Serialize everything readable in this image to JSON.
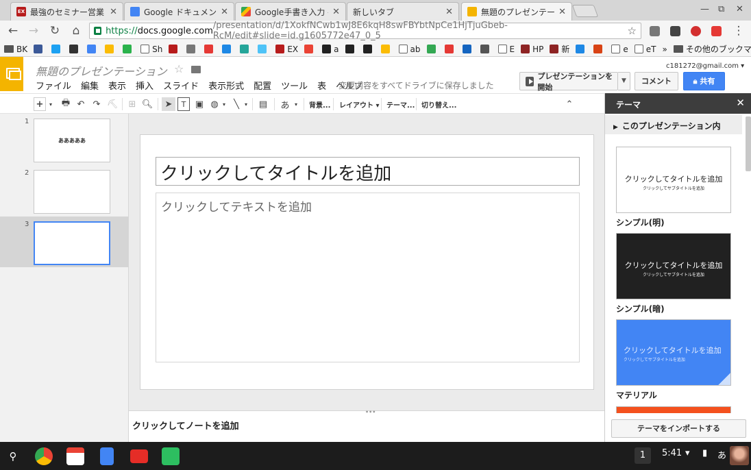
{
  "browser": {
    "tabs": [
      {
        "title": "最強のセミナー営業・",
        "favicon": "ex-icon",
        "color": "#b71c1c"
      },
      {
        "title": "Google ドキュメント",
        "favicon": "docs-icon",
        "color": "#4285f4"
      },
      {
        "title": "Google手書き入力 - Go",
        "favicon": "play-icon",
        "color": "#34a853"
      },
      {
        "title": "新しいタブ",
        "favicon": "",
        "color": ""
      },
      {
        "title": "無題のプレゼンテーシ",
        "favicon": "slides-icon",
        "color": "#f4b400"
      }
    ],
    "url": {
      "scheme": "https://",
      "host": "docs.google.com",
      "path": "/presentation/d/1XokfNCwb1wJ8E6kqH8swFBYbtNpCe1HjTjuGbeb-RcM/edit#slide=id.g1605772e47_0_5"
    },
    "bookmarks": [
      {
        "label": "BK",
        "icon": "folder-icon"
      },
      {
        "label": "",
        "icon": "facebook-icon"
      },
      {
        "label": "",
        "icon": "twitter-icon"
      },
      {
        "label": "",
        "icon": "bookmark-icon"
      },
      {
        "label": "",
        "icon": "google-icon"
      },
      {
        "label": "",
        "icon": "adwords-icon"
      },
      {
        "label": "",
        "icon": "feedly-icon"
      },
      {
        "label": "Sh",
        "icon": "page-icon"
      },
      {
        "label": "",
        "icon": "ex-icon"
      },
      {
        "label": "",
        "icon": "store-icon"
      },
      {
        "label": "",
        "icon": "ring-icon"
      },
      {
        "label": "",
        "icon": "chat-icon"
      },
      {
        "label": "",
        "icon": "app-icon"
      },
      {
        "label": "",
        "icon": "app2-icon"
      },
      {
        "label": "EX",
        "icon": "ex-icon"
      },
      {
        "label": "",
        "icon": "gmail-icon"
      },
      {
        "label": "a",
        "icon": "amazon-icon"
      },
      {
        "label": "",
        "icon": "t-icon"
      },
      {
        "label": "",
        "icon": "amazon-icon"
      },
      {
        "label": "",
        "icon": "photos-icon"
      },
      {
        "label": "ab",
        "icon": "page-icon"
      },
      {
        "label": "",
        "icon": "drive-icon"
      },
      {
        "label": "",
        "icon": "m-icon"
      },
      {
        "label": "",
        "icon": "arrow-icon"
      },
      {
        "label": "",
        "icon": "apple-icon"
      },
      {
        "label": "E",
        "icon": "page-icon"
      },
      {
        "label": "HP",
        "icon": "tax-icon"
      },
      {
        "label": "新",
        "icon": "tax-icon"
      },
      {
        "label": "",
        "icon": "mf-icon"
      },
      {
        "label": "",
        "icon": "time-icon"
      },
      {
        "label": "e",
        "icon": "page-icon"
      },
      {
        "label": "eT",
        "icon": "page-icon"
      }
    ],
    "bookmarks_overflow": "»",
    "other_bookmarks": "その他のブックマーク"
  },
  "app": {
    "doc_title": "無題のプレゼンテーション",
    "account": "c181272@gmail.com",
    "menu": [
      "ファイル",
      "編集",
      "表示",
      "挿入",
      "スライド",
      "表示形式",
      "配置",
      "ツール",
      "表",
      "ヘルプ"
    ],
    "save_status": "変更内容をすべてドライブに保存しました",
    "present_label": "プレゼンテーションを開始",
    "comment_label": "コメント",
    "share_label": "共有"
  },
  "toolbar": {
    "input_tool": "あ",
    "background": "背景...",
    "layout": "レイアウト",
    "theme": "テーマ...",
    "transition": "切り替え..."
  },
  "slides": [
    {
      "number": "1",
      "thumb_text": "あああああ",
      "selected": false
    },
    {
      "number": "2",
      "thumb_text": "",
      "selected": false
    },
    {
      "number": "3",
      "thumb_text": "",
      "selected": true
    }
  ],
  "canvas": {
    "title_placeholder": "クリックしてタイトルを追加",
    "body_placeholder": "クリックしてテキストを追加",
    "notes_placeholder": "クリックしてノートを追加"
  },
  "theme_panel": {
    "header": "テーマ",
    "section": "このプレゼンテーション内",
    "themes": [
      {
        "name": "シンプル(明)",
        "title": "クリックしてタイトルを追加",
        "subtitle": "クリックしてサブタイトルを追加",
        "bg": "#ffffff",
        "fg": "#222222"
      },
      {
        "name": "シンプル(暗)",
        "title": "クリックしてタイトルを追加",
        "subtitle": "クリックしてサブタイトルを追加",
        "bg": "#212121",
        "fg": "#ffffff"
      },
      {
        "name": "マテリアル",
        "title": "クリックしてタイトルを追加",
        "subtitle": "クリックしてサブタイトルを追加",
        "bg": "#4285f4",
        "fg": "#e3ecff"
      }
    ],
    "import_label": "テーマをインポートする"
  },
  "shelf": {
    "apps": [
      "search-icon",
      "chrome-icon",
      "gmail-icon",
      "docs-icon",
      "youtube-icon",
      "evernote-icon"
    ],
    "badge": "1",
    "time": "5:41",
    "ime": "あ"
  }
}
